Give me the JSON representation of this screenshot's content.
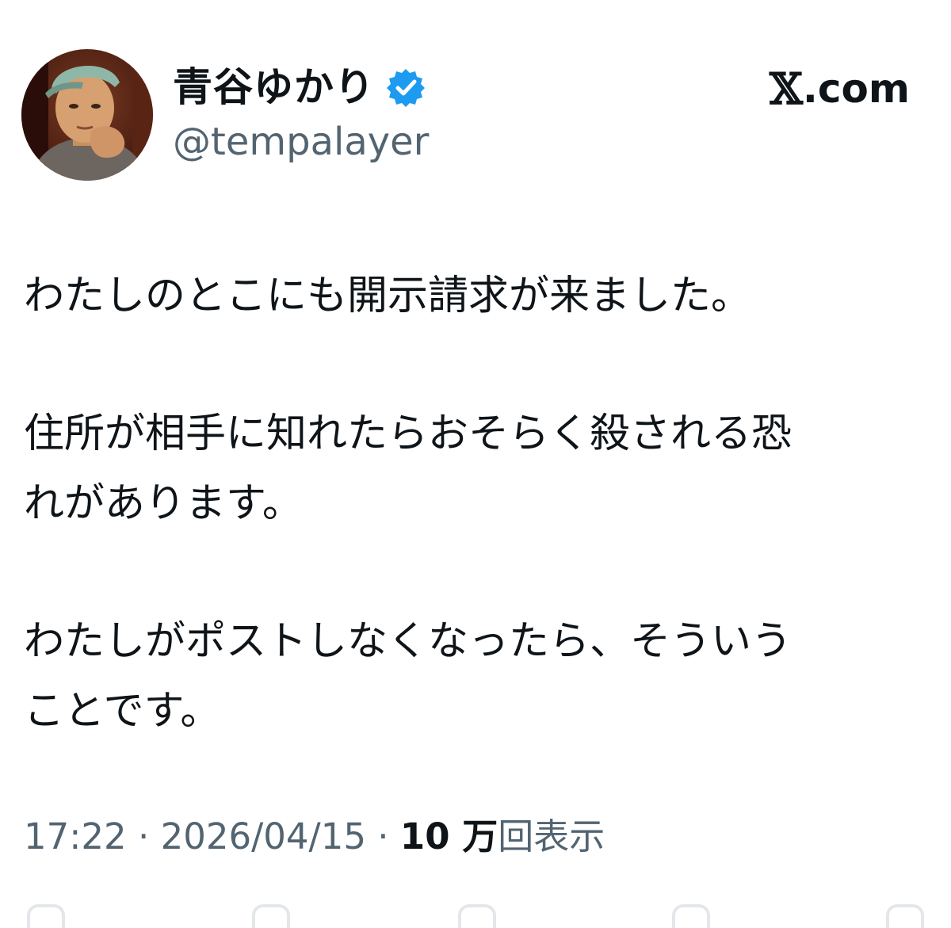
{
  "author": {
    "display_name": "青谷ゆかり",
    "handle": "@tempalayer",
    "verified": true,
    "verified_color": "#1d9bf0",
    "avatar_icon": "profile-photo"
  },
  "source": {
    "logo": "𝕏",
    "domain": ".com"
  },
  "post": {
    "paragraphs": [
      [
        "わたしのとこにも開示請求が来ました。"
      ],
      [
        "住所が相手に知れたらおそらく殺される恐",
        "れがあります。"
      ],
      [
        "わたしがポストしなくなったら、そういう",
        "ことです。"
      ]
    ]
  },
  "meta": {
    "time": "17:22",
    "separator": " · ",
    "date": "2026/04/15",
    "view_count": "10 万",
    "view_label": "回表示"
  },
  "colors": {
    "text": "#0f1419",
    "secondary": "#536471",
    "background": "#ffffff"
  },
  "actions": [
    {
      "icon": "reply-icon"
    },
    {
      "icon": "repost-icon"
    },
    {
      "icon": "like-icon"
    },
    {
      "icon": "bookmark-icon"
    },
    {
      "icon": "share-icon"
    }
  ]
}
